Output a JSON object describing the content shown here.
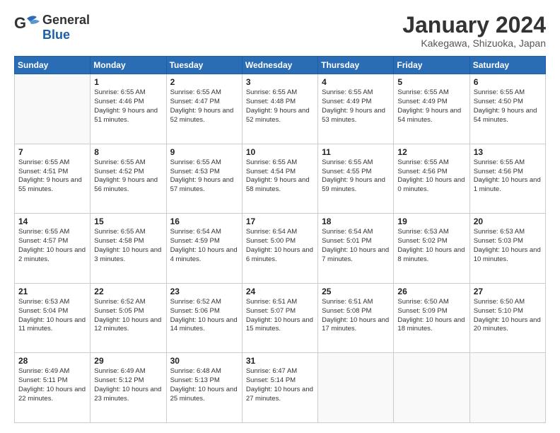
{
  "header": {
    "logo_general": "General",
    "logo_blue": "Blue",
    "month_title": "January 2024",
    "location": "Kakegawa, Shizuoka, Japan"
  },
  "days_of_week": [
    "Sunday",
    "Monday",
    "Tuesday",
    "Wednesday",
    "Thursday",
    "Friday",
    "Saturday"
  ],
  "weeks": [
    [
      {
        "day": "",
        "sunrise": "",
        "sunset": "",
        "daylight": ""
      },
      {
        "day": "1",
        "sunrise": "Sunrise: 6:55 AM",
        "sunset": "Sunset: 4:46 PM",
        "daylight": "Daylight: 9 hours and 51 minutes."
      },
      {
        "day": "2",
        "sunrise": "Sunrise: 6:55 AM",
        "sunset": "Sunset: 4:47 PM",
        "daylight": "Daylight: 9 hours and 52 minutes."
      },
      {
        "day": "3",
        "sunrise": "Sunrise: 6:55 AM",
        "sunset": "Sunset: 4:48 PM",
        "daylight": "Daylight: 9 hours and 52 minutes."
      },
      {
        "day": "4",
        "sunrise": "Sunrise: 6:55 AM",
        "sunset": "Sunset: 4:49 PM",
        "daylight": "Daylight: 9 hours and 53 minutes."
      },
      {
        "day": "5",
        "sunrise": "Sunrise: 6:55 AM",
        "sunset": "Sunset: 4:49 PM",
        "daylight": "Daylight: 9 hours and 54 minutes."
      },
      {
        "day": "6",
        "sunrise": "Sunrise: 6:55 AM",
        "sunset": "Sunset: 4:50 PM",
        "daylight": "Daylight: 9 hours and 54 minutes."
      }
    ],
    [
      {
        "day": "7",
        "sunrise": "Sunrise: 6:55 AM",
        "sunset": "Sunset: 4:51 PM",
        "daylight": "Daylight: 9 hours and 55 minutes."
      },
      {
        "day": "8",
        "sunrise": "Sunrise: 6:55 AM",
        "sunset": "Sunset: 4:52 PM",
        "daylight": "Daylight: 9 hours and 56 minutes."
      },
      {
        "day": "9",
        "sunrise": "Sunrise: 6:55 AM",
        "sunset": "Sunset: 4:53 PM",
        "daylight": "Daylight: 9 hours and 57 minutes."
      },
      {
        "day": "10",
        "sunrise": "Sunrise: 6:55 AM",
        "sunset": "Sunset: 4:54 PM",
        "daylight": "Daylight: 9 hours and 58 minutes."
      },
      {
        "day": "11",
        "sunrise": "Sunrise: 6:55 AM",
        "sunset": "Sunset: 4:55 PM",
        "daylight": "Daylight: 9 hours and 59 minutes."
      },
      {
        "day": "12",
        "sunrise": "Sunrise: 6:55 AM",
        "sunset": "Sunset: 4:56 PM",
        "daylight": "Daylight: 10 hours and 0 minutes."
      },
      {
        "day": "13",
        "sunrise": "Sunrise: 6:55 AM",
        "sunset": "Sunset: 4:56 PM",
        "daylight": "Daylight: 10 hours and 1 minute."
      }
    ],
    [
      {
        "day": "14",
        "sunrise": "Sunrise: 6:55 AM",
        "sunset": "Sunset: 4:57 PM",
        "daylight": "Daylight: 10 hours and 2 minutes."
      },
      {
        "day": "15",
        "sunrise": "Sunrise: 6:55 AM",
        "sunset": "Sunset: 4:58 PM",
        "daylight": "Daylight: 10 hours and 3 minutes."
      },
      {
        "day": "16",
        "sunrise": "Sunrise: 6:54 AM",
        "sunset": "Sunset: 4:59 PM",
        "daylight": "Daylight: 10 hours and 4 minutes."
      },
      {
        "day": "17",
        "sunrise": "Sunrise: 6:54 AM",
        "sunset": "Sunset: 5:00 PM",
        "daylight": "Daylight: 10 hours and 6 minutes."
      },
      {
        "day": "18",
        "sunrise": "Sunrise: 6:54 AM",
        "sunset": "Sunset: 5:01 PM",
        "daylight": "Daylight: 10 hours and 7 minutes."
      },
      {
        "day": "19",
        "sunrise": "Sunrise: 6:53 AM",
        "sunset": "Sunset: 5:02 PM",
        "daylight": "Daylight: 10 hours and 8 minutes."
      },
      {
        "day": "20",
        "sunrise": "Sunrise: 6:53 AM",
        "sunset": "Sunset: 5:03 PM",
        "daylight": "Daylight: 10 hours and 10 minutes."
      }
    ],
    [
      {
        "day": "21",
        "sunrise": "Sunrise: 6:53 AM",
        "sunset": "Sunset: 5:04 PM",
        "daylight": "Daylight: 10 hours and 11 minutes."
      },
      {
        "day": "22",
        "sunrise": "Sunrise: 6:52 AM",
        "sunset": "Sunset: 5:05 PM",
        "daylight": "Daylight: 10 hours and 12 minutes."
      },
      {
        "day": "23",
        "sunrise": "Sunrise: 6:52 AM",
        "sunset": "Sunset: 5:06 PM",
        "daylight": "Daylight: 10 hours and 14 minutes."
      },
      {
        "day": "24",
        "sunrise": "Sunrise: 6:51 AM",
        "sunset": "Sunset: 5:07 PM",
        "daylight": "Daylight: 10 hours and 15 minutes."
      },
      {
        "day": "25",
        "sunrise": "Sunrise: 6:51 AM",
        "sunset": "Sunset: 5:08 PM",
        "daylight": "Daylight: 10 hours and 17 minutes."
      },
      {
        "day": "26",
        "sunrise": "Sunrise: 6:50 AM",
        "sunset": "Sunset: 5:09 PM",
        "daylight": "Daylight: 10 hours and 18 minutes."
      },
      {
        "day": "27",
        "sunrise": "Sunrise: 6:50 AM",
        "sunset": "Sunset: 5:10 PM",
        "daylight": "Daylight: 10 hours and 20 minutes."
      }
    ],
    [
      {
        "day": "28",
        "sunrise": "Sunrise: 6:49 AM",
        "sunset": "Sunset: 5:11 PM",
        "daylight": "Daylight: 10 hours and 22 minutes."
      },
      {
        "day": "29",
        "sunrise": "Sunrise: 6:49 AM",
        "sunset": "Sunset: 5:12 PM",
        "daylight": "Daylight: 10 hours and 23 minutes."
      },
      {
        "day": "30",
        "sunrise": "Sunrise: 6:48 AM",
        "sunset": "Sunset: 5:13 PM",
        "daylight": "Daylight: 10 hours and 25 minutes."
      },
      {
        "day": "31",
        "sunrise": "Sunrise: 6:47 AM",
        "sunset": "Sunset: 5:14 PM",
        "daylight": "Daylight: 10 hours and 27 minutes."
      },
      {
        "day": "",
        "sunrise": "",
        "sunset": "",
        "daylight": ""
      },
      {
        "day": "",
        "sunrise": "",
        "sunset": "",
        "daylight": ""
      },
      {
        "day": "",
        "sunrise": "",
        "sunset": "",
        "daylight": ""
      }
    ]
  ]
}
